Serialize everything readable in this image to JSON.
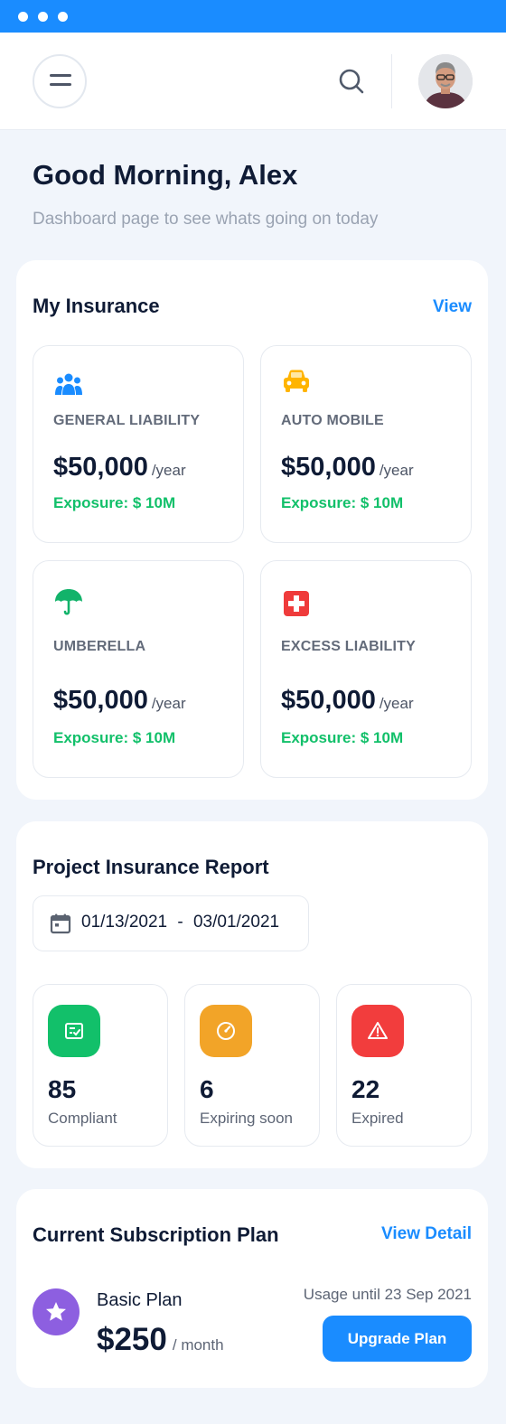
{
  "header": {
    "menu_icon": "hamburger-icon",
    "search_icon": "search-icon",
    "avatar": "user-avatar"
  },
  "greeting": {
    "title": "Good Morning, Alex",
    "subtitle": "Dashboard page to see whats going on today"
  },
  "my_insurance": {
    "title": "My Insurance",
    "view_label": "View",
    "cards": [
      {
        "icon": "people-icon",
        "name": "GENERAL LIABILITY",
        "price": "$50,000",
        "period": "/year",
        "exposure": "Exposure: $ 10M",
        "icon_color": "#1a8cff"
      },
      {
        "icon": "car-icon",
        "name": "AUTO MOBILE",
        "price": "$50,000",
        "period": "/year",
        "exposure": "Exposure: $ 10M",
        "icon_color": "#ffb400"
      },
      {
        "icon": "umbrella-icon",
        "name": "UMBERELLA",
        "price": "$50,000",
        "period": "/year",
        "exposure": "Exposure: $ 10M",
        "icon_color": "#12b36a"
      },
      {
        "icon": "medical-cross-icon",
        "name": "EXCESS LIABILITY",
        "price": "$50,000",
        "period": "/year",
        "exposure": "Exposure: $ 10M",
        "icon_color": "#ef3b3b"
      }
    ]
  },
  "report": {
    "title": "Project Insurance Report",
    "date_from": "01/13/2021",
    "date_separator": "-",
    "date_to": "03/01/2021",
    "stats": [
      {
        "icon": "checklist-icon",
        "value": "85",
        "label": "Compliant",
        "color": "#12c06a"
      },
      {
        "icon": "gauge-icon",
        "value": "6",
        "label": "Expiring soon",
        "color": "#f2a428"
      },
      {
        "icon": "warning-icon",
        "value": "22",
        "label": "Expired",
        "color": "#f23d3d"
      }
    ]
  },
  "subscription": {
    "title": "Current Subscription Plan",
    "view_detail_label": "View Detail",
    "plan_icon": "star-icon",
    "plan_name": "Basic Plan",
    "price": "$250",
    "period": "/ month",
    "usage": "Usage until 23 Sep 2021",
    "upgrade_label": "Upgrade Plan"
  },
  "colors": {
    "accent": "#1a8cff",
    "exposure": "#12c06a",
    "background": "#f1f5fb"
  }
}
